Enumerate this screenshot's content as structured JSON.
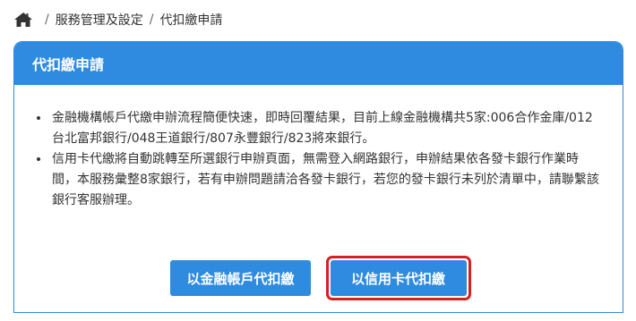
{
  "breadcrumb": {
    "home_icon": "home-icon",
    "separator": "/",
    "items": [
      "服務管理及設定",
      "代扣繳申請"
    ]
  },
  "panel": {
    "title": "代扣繳申請",
    "notes": [
      "金融機構帳戶代繳申辦流程簡便快速，即時回覆結果，目前上線金融機構共5家:006合作金庫/012台北富邦銀行/048王道銀行/807永豐銀行/823將來銀行。",
      "信用卡代繳將自動跳轉至所選銀行申辦頁面，無需登入網路銀行，申辦結果依各發卡銀行作業時間，本服務彙整8家銀行，若有申辦問題請洽各發卡銀行，若您的發卡銀行未列於清單中，請聯繫該銀行客服辦理。"
    ],
    "buttons": {
      "bank_account": "以金融帳戶代扣繳",
      "credit_card": "以信用卡代扣繳"
    }
  },
  "colors": {
    "accent": "#2f8be0",
    "highlight": "#d92020"
  }
}
